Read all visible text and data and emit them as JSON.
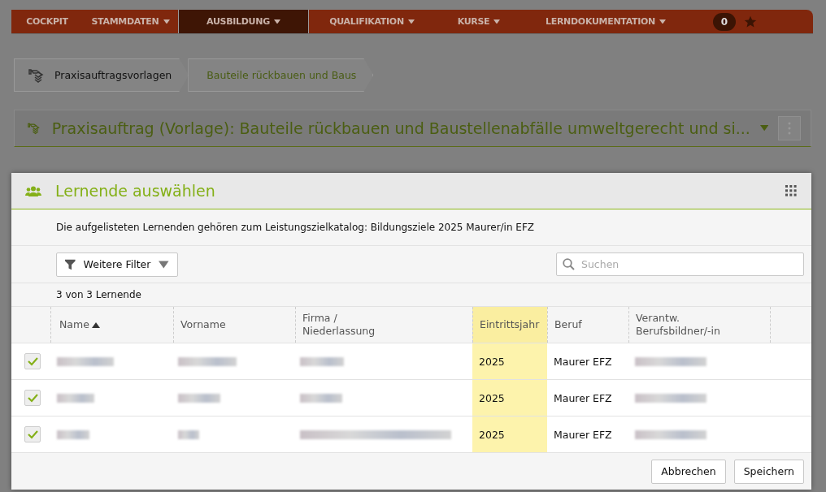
{
  "nav": {
    "items": [
      {
        "label": "COCKPIT",
        "dropdown": false,
        "selected": false
      },
      {
        "label": "STAMMDATEN",
        "dropdown": true,
        "selected": false
      },
      {
        "label": "AUSBILDUNG",
        "dropdown": true,
        "selected": true
      },
      {
        "label": "QUALIFIKATION",
        "dropdown": true,
        "selected": false
      },
      {
        "label": "KURSE",
        "dropdown": true,
        "selected": false
      },
      {
        "label": "LERNDOKUMENTATION",
        "dropdown": true,
        "selected": false
      }
    ],
    "badge": "0"
  },
  "breadcrumbs": [
    {
      "label": "Praxisauftragsvorlagen",
      "selected": false
    },
    {
      "label": "Bauteile rückbauen und Baus",
      "selected": true
    }
  ],
  "panel": {
    "title": "Praxisauftrag (Vorlage): Bauteile rückbauen und Baustellenabfälle umweltgerecht und si..."
  },
  "dialog": {
    "title": "Lernende auswählen",
    "info": "Die aufgelisteten Lernenden gehören zum Leistungszielkatalog: Bildungsziele 2025 Maurer/in EFZ",
    "filter_button": "Weitere Filter",
    "search": {
      "placeholder": "Suchen"
    },
    "count": "3 von 3 Lernende",
    "columns": [
      {
        "label": "Name",
        "sorted": true,
        "highlighted": false
      },
      {
        "label": "Vorname",
        "sorted": false,
        "highlighted": false
      },
      {
        "label": "Firma / Niederlassung",
        "sorted": false,
        "highlighted": false
      },
      {
        "label": "Eintrittsjahr",
        "sorted": false,
        "highlighted": true
      },
      {
        "label": "Beruf",
        "sorted": false,
        "highlighted": false
      },
      {
        "label": "Verantw. Berufsbildner/-in",
        "sorted": false,
        "highlighted": false
      }
    ],
    "rows": [
      {
        "checked": true,
        "eintrittsjahr": "2025",
        "beruf": "Maurer EFZ"
      },
      {
        "checked": true,
        "eintrittsjahr": "2025",
        "beruf": "Maurer EFZ"
      },
      {
        "checked": true,
        "eintrittsjahr": "2025",
        "beruf": "Maurer EFZ"
      }
    ],
    "buttons": [
      "Abbrechen",
      "Speichern"
    ]
  }
}
